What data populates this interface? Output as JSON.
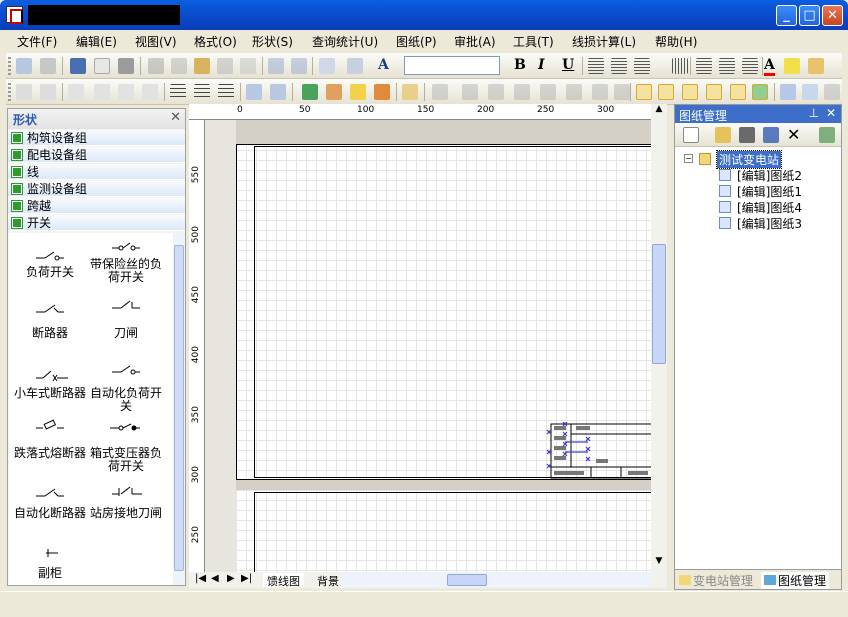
{
  "colors": {
    "titlebar": "#0b4fd0",
    "menu_bg": "#ece9d8",
    "panel_header_bg": "#3d6fca",
    "group_icon": "#2f9b2f"
  },
  "menu": [
    "文件(F)",
    "编辑(E)",
    "视图(V)",
    "格式(O)",
    "形状(S)",
    "查询统计(U)",
    "图纸(P)",
    "审批(A)",
    "工具(T)",
    "线损计算(L)",
    "帮助(H)"
  ],
  "toolbar": {
    "bold": "B",
    "italic": "I",
    "underline": "U",
    "font_color_label": "A"
  },
  "shapes_panel": {
    "title": "形状",
    "groups": [
      "构筑设备组",
      "配电设备组",
      "线",
      "监测设备组",
      "跨越",
      "开关"
    ],
    "shapes": [
      {
        "label": "负荷开关"
      },
      {
        "label": "带保险丝的负荷开关"
      },
      {
        "label": "断路器"
      },
      {
        "label": "刀闸"
      },
      {
        "label": "小车式断路器"
      },
      {
        "label": "自动化负荷开关"
      },
      {
        "label": "跌落式熔断器"
      },
      {
        "label": "箱式变压器负荷开关"
      },
      {
        "label": "自动化断路器"
      },
      {
        "label": "站房接地刀闸"
      },
      {
        "label": "副柜"
      }
    ]
  },
  "ruler": {
    "h": [
      "0",
      "50",
      "100",
      "150",
      "200",
      "250",
      "300"
    ],
    "v": [
      "550",
      "500",
      "450",
      "400",
      "350",
      "300",
      "250"
    ]
  },
  "sheet_tabs": [
    "馈线图",
    "背景"
  ],
  "right_panel": {
    "title": "图纸管理",
    "tree_root": "测试变电站",
    "tree_items": [
      "[编辑]图纸2",
      "[编辑]图纸1",
      "[编辑]图纸4",
      "[编辑]图纸3"
    ],
    "tabs": [
      "变电站管理",
      "图纸管理"
    ]
  }
}
